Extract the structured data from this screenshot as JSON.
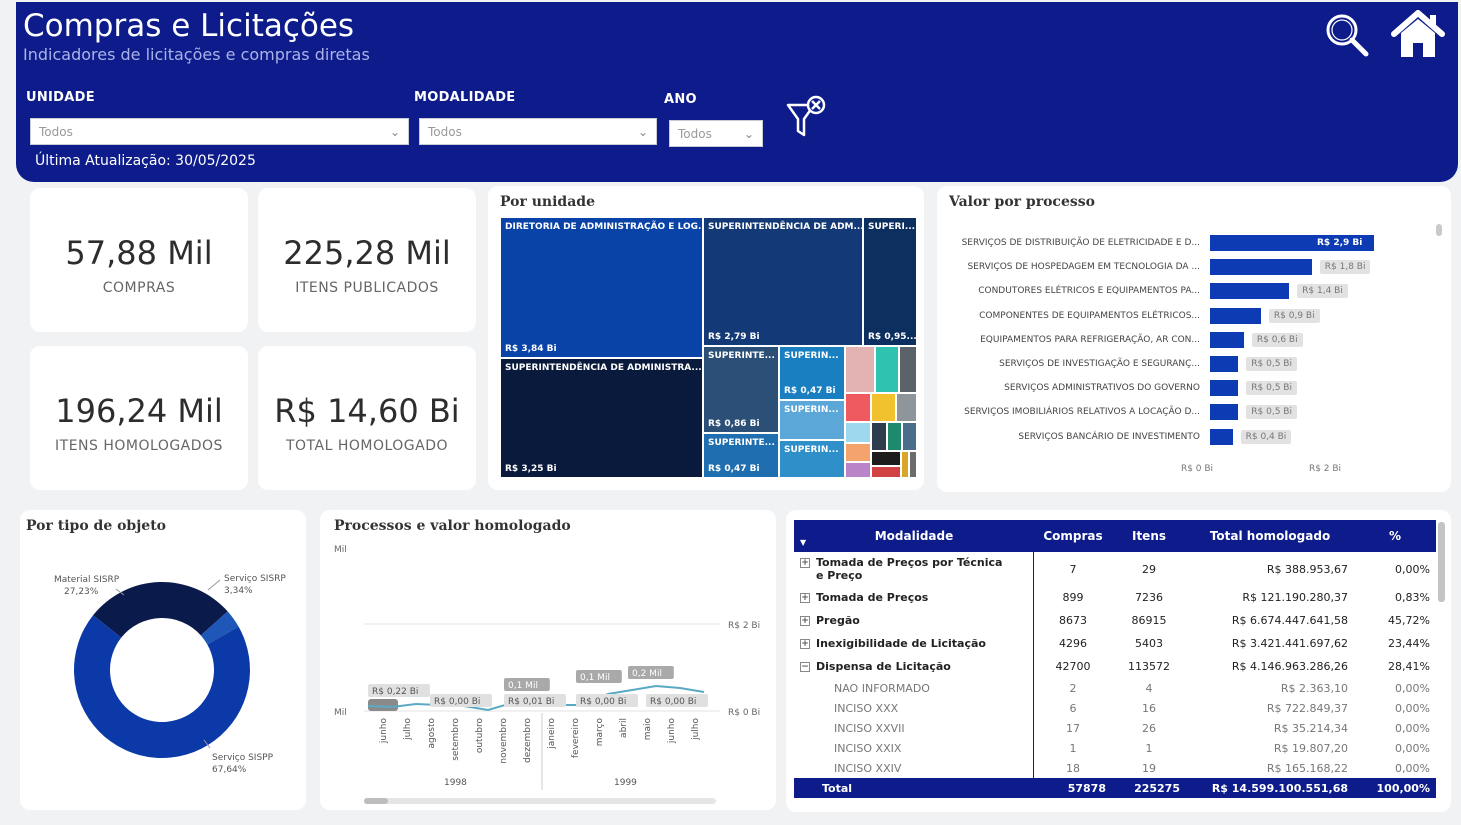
{
  "header": {
    "title": "Compras e Licitações",
    "subtitle": "Indicadores de licitações e compras diretas",
    "last_update": "Última Atualização: 30/05/2025",
    "search_icon": "search-icon",
    "home_icon": "home-icon",
    "clear_filters_icon": "filter-clear-icon"
  },
  "filters": {
    "unidade": {
      "label": "UNIDADE",
      "value": "Todos"
    },
    "modalidade": {
      "label": "MODALIDADE",
      "value": "Todos"
    },
    "ano": {
      "label": "ANO",
      "value": "Todos"
    }
  },
  "kpis": [
    {
      "value": "57,88 Mil",
      "label": "COMPRAS"
    },
    {
      "value": "225,28 Mil",
      "label": "ITENS PUBLICADOS"
    },
    {
      "value": "196,24 Mil",
      "label": "ITENS HOMOLOGADOS"
    },
    {
      "value": "R$ 14,60 Bi",
      "label": "TOTAL HOMOLOGADO"
    }
  ],
  "treemap": {
    "title": "Por unidade",
    "tiles": [
      {
        "name": "DIRETORIA DE ADMINISTRAÇÃO E LOG...",
        "value": "R$ 3,84 Bi"
      },
      {
        "name": "SUPERINTENDÊNCIA DE ADM...",
        "value": "R$ 2,79 Bi"
      },
      {
        "name": "SUPERI...",
        "value": "R$ 0,95..."
      },
      {
        "name": "SUPERINTENDÊNCIA DE ADMINISTRA...",
        "value": "R$ 3,25 Bi"
      },
      {
        "name": "SUPERINTE...",
        "value": "R$ 0,86 Bi"
      },
      {
        "name": "SUPERIN...",
        "value": "R$ 0,47 Bi"
      },
      {
        "name": "SUPERIN...",
        "value": ""
      },
      {
        "name": "SUPERINTE...",
        "value": "R$ 0,47 Bi"
      },
      {
        "name": "SUPERIN...",
        "value": ""
      }
    ]
  },
  "valor_processo": {
    "title": "Valor por processo",
    "axis": [
      "R$ 0 Bi",
      "R$ 2 Bi"
    ]
  },
  "tipo_objeto": {
    "title": "Por tipo de objeto",
    "labels": [
      {
        "name": "Material SISRP",
        "pct": "27,23%"
      },
      {
        "name": "Serviço SISRP",
        "pct": "3,34%"
      },
      {
        "name": "Serviço SISPP",
        "pct": "67,64%"
      }
    ]
  },
  "processos": {
    "title": "Processos e valor homologado",
    "y_left_top": "Mil",
    "y_left_bottom": "Mil",
    "y_right": [
      "R$ 2 Bi",
      "R$ 0 Bi"
    ],
    "data_labels": [
      "R$ 0,22 Bi",
      "R$ 0,00 Bi",
      "0,1 Mil",
      "R$ 0,01 Bi",
      "0,1 Mil",
      "R$ 0,00 Bi",
      "0,2 Mil",
      "R$ 0,00 Bi"
    ],
    "months": [
      "junho",
      "julho",
      "agosto",
      "setembro",
      "outubro",
      "novembro",
      "dezembro",
      "janeiro",
      "fevereiro",
      "março",
      "abril",
      "maio",
      "junho",
      "julho"
    ],
    "years": [
      "1998",
      "1999"
    ]
  },
  "table": {
    "columns": [
      "Modalidade",
      "Compras",
      "Itens",
      "Total homologado",
      "%"
    ],
    "rows": [
      {
        "name": "Tomada de Preços por Técnica e Preço",
        "compras": "7",
        "itens": "29",
        "total": "R$ 388.953,67",
        "pct": "0,00%"
      },
      {
        "name": "Tomada de Preços",
        "compras": "899",
        "itens": "7236",
        "total": "R$ 121.190.280,37",
        "pct": "0,83%"
      },
      {
        "name": "Pregão",
        "compras": "8673",
        "itens": "86915",
        "total": "R$ 6.674.447.641,58",
        "pct": "45,72%"
      },
      {
        "name": "Inexigibilidade de Licitação",
        "compras": "4296",
        "itens": "5403",
        "total": "R$ 3.421.441.697,62",
        "pct": "23,44%"
      },
      {
        "name": "Dispensa de Licitação",
        "compras": "42700",
        "itens": "113572",
        "total": "R$ 4.146.963.286,26",
        "pct": "28,41%"
      }
    ],
    "subrows": [
      {
        "name": "NAO INFORMADO",
        "compras": "2",
        "itens": "4",
        "total": "R$ 2.363,10",
        "pct": "0,00%"
      },
      {
        "name": "INCISO XXX",
        "compras": "6",
        "itens": "16",
        "total": "R$ 722.849,37",
        "pct": "0,00%"
      },
      {
        "name": "INCISO XXVII",
        "compras": "17",
        "itens": "26",
        "total": "R$ 35.214,34",
        "pct": "0,00%"
      },
      {
        "name": "INCISO XXIX",
        "compras": "1",
        "itens": "1",
        "total": "R$ 19.807,20",
        "pct": "0,00%"
      },
      {
        "name": "INCISO XXIV",
        "compras": "18",
        "itens": "19",
        "total": "R$ 165.168,22",
        "pct": "0,00%"
      }
    ],
    "total": {
      "name": "Total",
      "compras": "57878",
      "itens": "225275",
      "total": "R$ 14.599.100.551,68",
      "pct": "100,00%"
    }
  },
  "chart_data": [
    {
      "type": "bar",
      "title": "Valor por processo",
      "categories": [
        "SERVIÇOS DE DISTRIBUIÇÃO DE ELETRICIDADE E D...",
        "SERVIÇOS DE HOSPEDAGEM EM TECNOLOGIA DA ...",
        "CONDUTORES ELÉTRICOS E EQUIPAMENTOS PA...",
        "COMPONENTES DE EQUIPAMENTOS ELÉTRICOS...",
        "EQUIPAMENTOS PARA REFRIGERAÇÃO, AR CON...",
        "SERVIÇOS DE INVESTIGAÇÃO E SEGURANÇ...",
        "SERVIÇOS ADMINISTRATIVOS DO GOVERNO",
        "SERVIÇOS IMOBILIÁRIOS RELATIVOS A LOCAÇÃO D...",
        "SERVIÇOS BANCÁRIO DE INVESTIMENTO"
      ],
      "values": [
        2.9,
        1.8,
        1.4,
        0.9,
        0.6,
        0.5,
        0.5,
        0.5,
        0.4
      ],
      "value_labels": [
        "R$ 2,9 Bi",
        "R$ 1,8 Bi",
        "R$ 1,4 Bi",
        "R$ 0,9 Bi",
        "R$ 0,6 Bi",
        "R$ 0,5 Bi",
        "R$ 0,5 Bi",
        "R$ 0,5 Bi",
        "R$ 0,4 Bi"
      ],
      "xlim": [
        0,
        2.9
      ],
      "xticks": [
        "R$ 0 Bi",
        "R$ 2 Bi"
      ],
      "color": "#0d3bb3"
    },
    {
      "type": "pie",
      "title": "Por tipo de objeto",
      "categories": [
        "Serviço SISPP",
        "Material SISRP",
        "Serviço SISRP"
      ],
      "values": [
        67.64,
        27.23,
        3.34
      ],
      "colors": [
        "#0b3aa8",
        "#0a1a4a",
        "#1e57b8"
      ]
    },
    {
      "type": "line",
      "title": "Processos e valor homologado",
      "x": [
        "junho",
        "julho",
        "agosto",
        "setembro",
        "outubro",
        "novembro",
        "dezembro",
        "janeiro",
        "fevereiro",
        "março",
        "abril",
        "maio",
        "junho",
        "julho"
      ],
      "series": [
        {
          "values": [
            0.22,
            0.0,
            0.0,
            0.0,
            0.0,
            0.01,
            0.01,
            0.0,
            0.0,
            0.0,
            0.0,
            0.0,
            0.0,
            0.0
          ]
        }
      ],
      "ylim": [
        0,
        2
      ]
    }
  ]
}
